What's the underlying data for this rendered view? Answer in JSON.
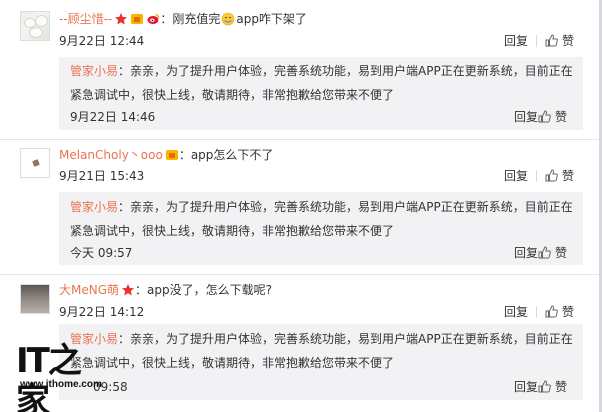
{
  "comments": [
    {
      "username": "--顾尘惜--",
      "text": "：刚充值完",
      "text_tail": "app咋下架了",
      "time": "9月22日 12:44",
      "reply_label": "回复",
      "like_label": "赞",
      "official_reply": {
        "name": "管家小易",
        "text": "：亲亲，为了提升用户体验，完善系统功能，易到用户端APP正在更新系统，目前正在紧急调试中，很快上线，敬请期待，非常抱歉给您带来不便了",
        "time": "9月22日 14:46",
        "reply_label": "回复",
        "like_label": "赞"
      }
    },
    {
      "username": "MelanCholy丶ooo",
      "text": "：app怎么下不了",
      "time": "9月21日 15:43",
      "reply_label": "回复",
      "like_label": "赞",
      "official_reply": {
        "name": "管家小易",
        "text": "：亲亲，为了提升用户体验，完善系统功能，易到用户端APP正在更新系统，目前正在紧急调试中，很快上线，敬请期待，非常抱歉给您带来不便了",
        "time": "今天 09:57",
        "reply_label": "回复",
        "like_label": "赞"
      }
    },
    {
      "username": "大MeNG萌",
      "text": "：app没了，怎么下载呢?",
      "time": "9月22日 14:12",
      "reply_label": "回复",
      "like_label": "赞",
      "official_reply": {
        "name": "管家小易",
        "text": "：亲亲，为了提升用户体验，完善系统功能，易到用户端APP正在更新系统，目前正在紧急调试中，很快上线，敬请期待，非常抱歉给您带来不便了",
        "time": "09:58",
        "reply_label": "回复",
        "like_label": "赞"
      }
    }
  ],
  "watermark": {
    "logo": "IT之家",
    "url": "www.ithome.com"
  },
  "colors": {
    "username": "#eb7350",
    "reply_bg": "#f2f2f5",
    "text": "#333333"
  }
}
